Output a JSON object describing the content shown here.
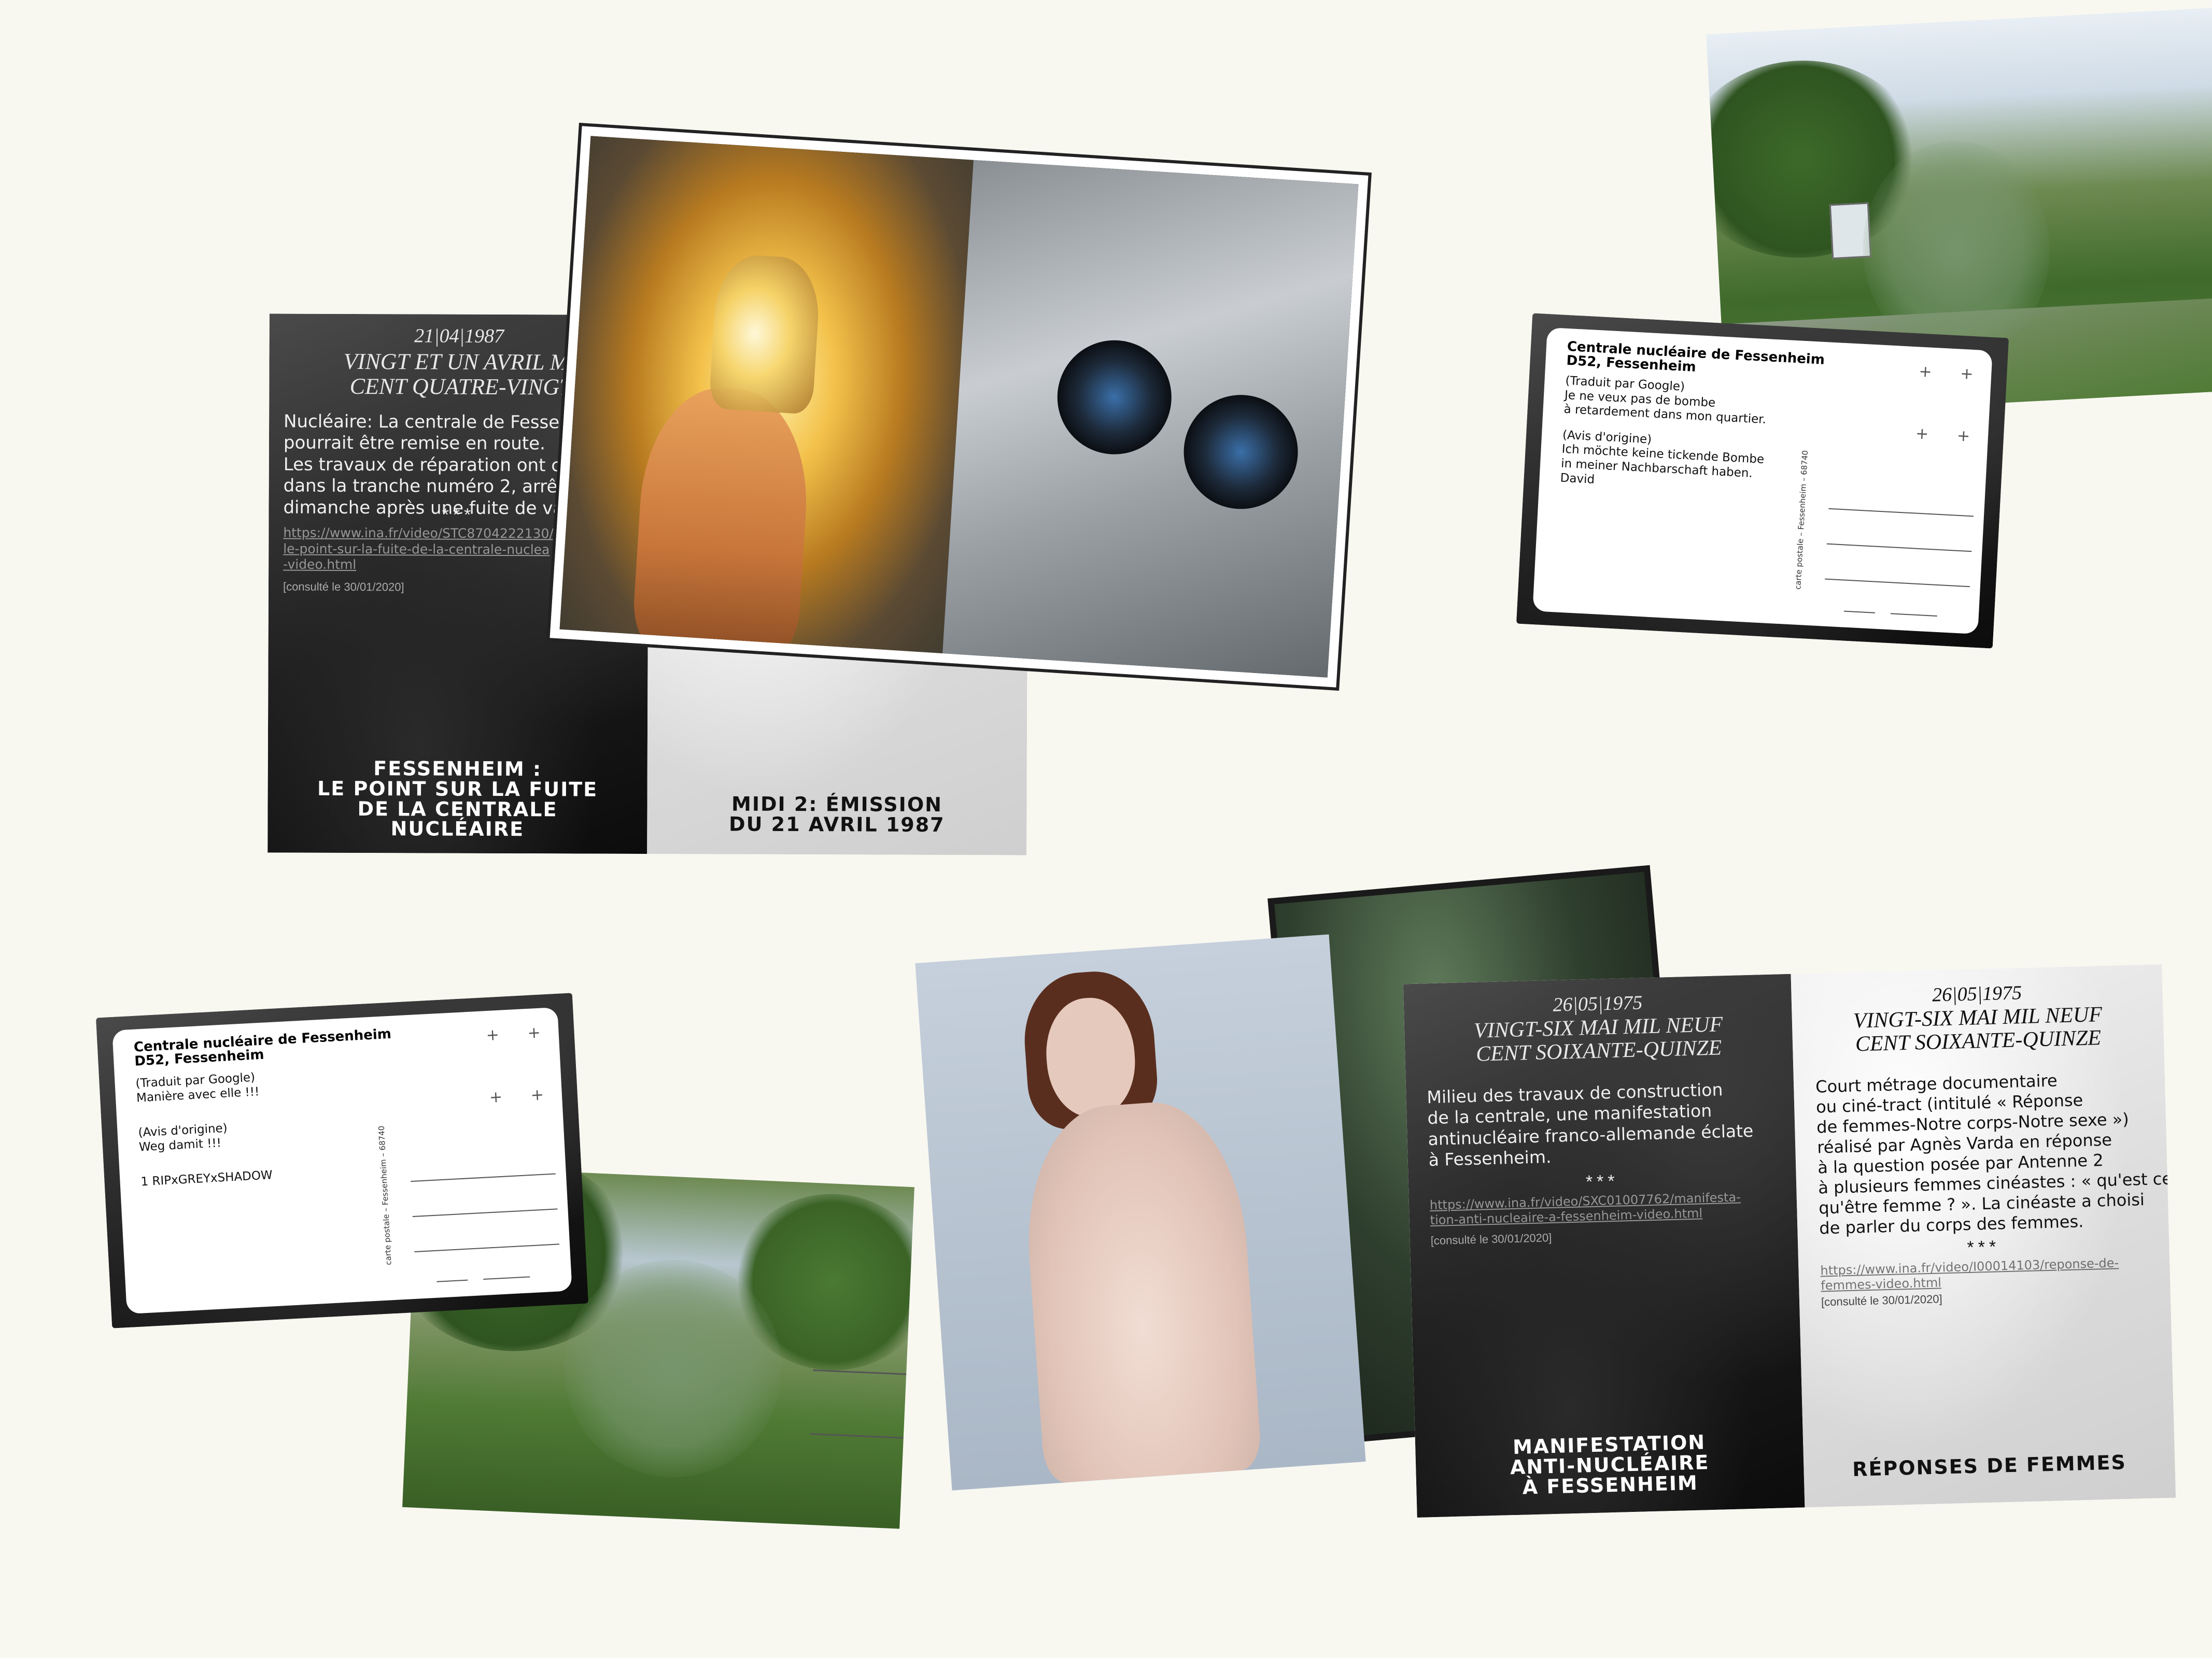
{
  "card1": {
    "date": "21|04|1987",
    "heading_l1": "VINGT ET UN AVRIL MIL N",
    "heading_l2": "CENT QUATRE-VINGT-SE",
    "body_l1": "Nucléaire: La centrale de Fessenhei",
    "body_l2": "pourrait être remise en route.",
    "body_l3": "Les travaux de réparation ont comm",
    "body_l4": "dans la tranche numéro 2, arrêtée d",
    "body_l5": "dimanche après une fuite de vapeu",
    "stars": "***",
    "link_l1": "https://www.ina.fr/video/STC8704222130/fe",
    "link_l2": "le-point-sur-la-fuite-de-la-centrale-nuclea",
    "link_l3": "-video.html",
    "consulted": "[consulté le 30/01/2020]",
    "caption_left_l1": "FESSENHEIM :",
    "caption_left_l2": "LE POINT SUR LA FUITE",
    "caption_left_l3": "DE LA CENTRALE",
    "caption_left_l4": "NUCLÉAIRE",
    "caption_right_l1": "MIDI 2: ÉMISSION",
    "caption_right_l2": "DU 21 AVRIL 1987"
  },
  "postcard1": {
    "title_l1": "Centrale nucléaire de Fessenheim",
    "title_l2": "D52, Fessenheim",
    "trans_label": "(Traduit par Google)",
    "trans_l1": "Je ne veux pas de bombe",
    "trans_l2": "à retardement dans mon quartier.",
    "orig_label": "(Avis d'origine)",
    "orig_l1": "Ich möchte keine tickende Bombe",
    "orig_l2": "in meiner Nachbarschaft haben.",
    "author": "David",
    "vertical": "carte postale – Fessenheim – 68740",
    "plus": "+"
  },
  "postcard2": {
    "title_l1": "Centrale nucléaire de Fessenheim",
    "title_l2": "D52, Fessenheim",
    "trans_label": "(Traduit par Google)",
    "trans_l1": "Manière avec elle !!!",
    "orig_label": "(Avis d'origine)",
    "orig_l1": "Weg damit !!!",
    "author": "1 RIPxGREYxSHADOW",
    "vertical": "carte postale – Fessenheim – 68740",
    "plus": "+"
  },
  "card2": {
    "left_date": "26|05|1975",
    "left_heading_l1": "VINGT-SIX MAI MIL NEUF",
    "left_heading_l2": "CENT SOIXANTE-QUINZE",
    "left_body_l1": "Milieu des travaux de construction",
    "left_body_l2": "de la centrale, une manifestation",
    "left_body_l3": "antinucléaire franco-allemande éclate",
    "left_body_l4": "à Fessenheim.",
    "left_stars": "***",
    "left_link_l1": "https://www.ina.fr/video/SXC01007762/manifesta-",
    "left_link_l2": "tion-anti-nucleaire-a-fessenheim-video.html",
    "left_consulted": "[consulté le 30/01/2020]",
    "left_caption_l1": "MANIFESTATION",
    "left_caption_l2": "ANTI-NUCLÉAIRE",
    "left_caption_l3": "À FESSENHEIM",
    "right_date": "26|05|1975",
    "right_heading_l1": "VINGT-SIX MAI MIL NEUF",
    "right_heading_l2": "CENT SOIXANTE-QUINZE",
    "right_body_l1": "Court métrage documentaire",
    "right_body_l2": "ou ciné-tract (intitulé « Réponse",
    "right_body_l3": "de femmes-Notre corps-Notre sexe »)",
    "right_body_l4": "réalisé par Agnès Varda en réponse",
    "right_body_l5": "à la question posée par Antenne 2",
    "right_body_l6": "à plusieurs femmes cinéastes : « qu'est ce",
    "right_body_l7": "qu'être femme ? ». La cinéaste a choisi",
    "right_body_l8": "de parler du corps des femmes.",
    "right_stars": "***",
    "right_link_l1": "https://www.ina.fr/video/I00014103/reponse-de-",
    "right_link_l2": "femmes-video.html",
    "right_consulted": "[consulté le 30/01/2020]",
    "right_caption": "RÉPONSES DE FEMMES"
  }
}
